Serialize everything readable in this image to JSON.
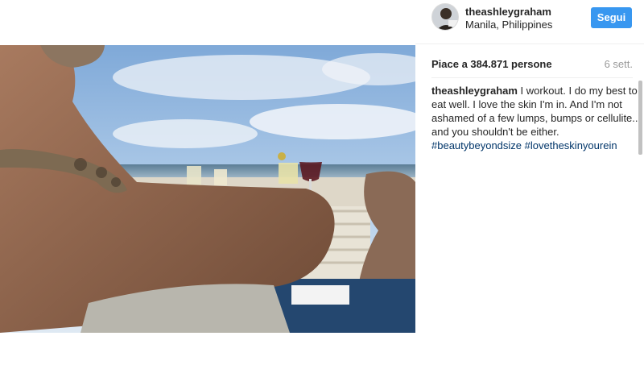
{
  "post": {
    "image_alt": "Beach photo with cocktails on a table",
    "author": {
      "username": "theashleygraham",
      "location": "Manila, Philippines",
      "avatar_icon": "avatar-photo"
    },
    "follow_label": "Segui",
    "likes_text": "Piace a 384.871 persone",
    "time_ago": "6 sett.",
    "caption": {
      "author": "theashleygraham",
      "text": " I workout. I do my best to eat well. I love the skin I'm in. And I'm not ashamed of a few lumps, bumps or cellulite.. and you shouldn't be either.",
      "hashtags": [
        "#beautybeyondsize",
        "#lovetheskinyourein"
      ]
    }
  },
  "colors": {
    "follow_button": "#3897f0",
    "hashtag": "#003569",
    "muted": "#999999"
  }
}
